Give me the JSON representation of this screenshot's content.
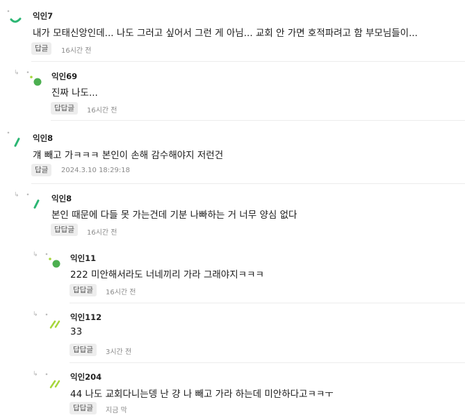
{
  "comments": [
    {
      "author": "익인7",
      "text": "내가 모태신앙인데... 나도 그러고 싶어서 그런 게 아님... 교회 안 가면 호적파려고 함 부모님들이...",
      "reply_label": "답글",
      "time": "16시간 전"
    },
    {
      "author": "익인69",
      "text": "진짜 나도...",
      "reply_label": "답답글",
      "time": "16시간 전"
    },
    {
      "author": "익인8",
      "text": "걔 빼고 가ㅋㅋㅋ 본인이 손해 감수해야지 저런건",
      "reply_label": "답글",
      "time": "2024.3.10 18:29:18"
    },
    {
      "author": "익인8",
      "text": "본인 때문에 다들 못 가는건데 기분 나빠하는 거 너무 양심 없다",
      "reply_label": "답답글",
      "time": "16시간 전"
    },
    {
      "author": "익인11",
      "text": "222 미안해서라도 너네끼리 가라 그래야지ㅋㅋㅋ",
      "reply_label": "답답글",
      "time": "16시간 전"
    },
    {
      "author": "익인112",
      "text": "33",
      "reply_label": "답답글",
      "time": "3시간 전"
    },
    {
      "author": "익인204",
      "text": "44 나도 교회다니는뎅 난 걍 나 빼고 가라 하는데 미안하다고ㅋㅋㅜ",
      "reply_label": "답답글",
      "time": "지금 막"
    }
  ],
  "colors": {
    "green_dark": "#2bb673",
    "green_light": "#a6d63b",
    "green_circle": "#4caf50"
  }
}
